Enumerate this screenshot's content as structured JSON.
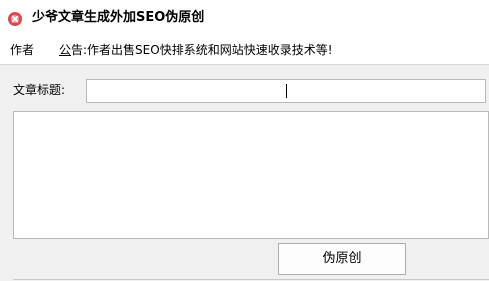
{
  "window": {
    "title": "少爷文章生成外加SEO伪原创",
    "icon": "app-logo-icon",
    "accent_color": "#e0464c"
  },
  "menubar": {
    "items": [
      {
        "label": "作者"
      },
      {
        "accel": "公",
        "label_rest": "告:作者出售SEO快排系统和网站快速收录技术等!"
      }
    ]
  },
  "form": {
    "title_label": "文章标题:",
    "title_value": "",
    "body_value": "",
    "submit_label": "伪原创"
  }
}
